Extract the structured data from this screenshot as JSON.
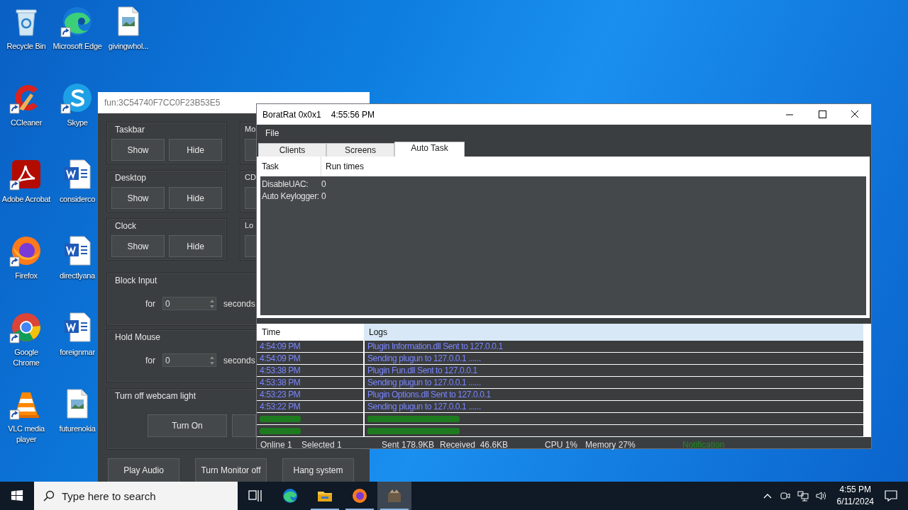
{
  "desktop_icons": [
    {
      "label": "Recycle Bin",
      "kind": "recycle-bin",
      "shortcut": false
    },
    {
      "label": "CCleaner",
      "kind": "ccleaner",
      "shortcut": true
    },
    {
      "label": "Adobe Acrobat",
      "kind": "acrobat",
      "shortcut": true
    },
    {
      "label": "Firefox",
      "kind": "firefox",
      "shortcut": true
    },
    {
      "label": "Google Chrome",
      "kind": "chrome",
      "shortcut": true
    },
    {
      "label": "VLC media player",
      "kind": "vlc",
      "shortcut": true
    },
    {
      "label": "Microsoft Edge",
      "kind": "edge",
      "shortcut": true
    },
    {
      "label": "Skype",
      "kind": "skype",
      "shortcut": true
    },
    {
      "label": "considerco",
      "kind": "word-doc",
      "shortcut": false
    },
    {
      "label": "directlyana",
      "kind": "word-doc",
      "shortcut": false
    },
    {
      "label": "foreignmar",
      "kind": "word-doc",
      "shortcut": false
    },
    {
      "label": "futurenokia",
      "kind": "image-file",
      "shortcut": false
    },
    {
      "label": "givingwhol...",
      "kind": "image-file",
      "shortcut": false
    }
  ],
  "fun_window": {
    "title": "fun:3C54740F7CC0F23B53E5",
    "groups": [
      {
        "title": "Taskbar",
        "buttons": [
          "Show",
          "Hide"
        ]
      },
      {
        "title": "Mo"
      },
      {
        "title": "Desktop",
        "buttons": [
          "Show",
          "Hide"
        ]
      },
      {
        "title": "CD"
      },
      {
        "title": "Clock",
        "buttons": [
          "Show",
          "Hide"
        ]
      },
      {
        "title": "Lo"
      }
    ],
    "timers": [
      {
        "title": "Block Input",
        "for": "for",
        "value": "0",
        "unit": "seconds"
      },
      {
        "title": "Hold Mouse",
        "for": "for",
        "value": "0",
        "unit": "seconds"
      }
    ],
    "webcam": {
      "title": "Turn off webcam light",
      "button": "Turn On"
    },
    "bottom_buttons": [
      "Play Audio",
      "Turn Monitor off",
      "Hang system"
    ]
  },
  "rat_window": {
    "title": "BoratRat 0x0x1",
    "time": "4:55:56 PM",
    "menu": [
      "File"
    ],
    "tabs": [
      {
        "label": "Clients",
        "selected": false
      },
      {
        "label": "Screens",
        "selected": false
      },
      {
        "label": "Auto Task",
        "selected": true
      }
    ],
    "task_table": {
      "columns": [
        "Task",
        "Run times"
      ],
      "rows": [
        [
          "DisableUAC:",
          "0"
        ],
        [
          "Auto Keylogger:",
          "0"
        ]
      ]
    },
    "log_table": {
      "columns": [
        "Time",
        "Logs"
      ],
      "rows": [
        {
          "time": "4:54:09 PM",
          "message": "Plugin Information.dll Sent to 127.0.0.1",
          "kind": "info"
        },
        {
          "time": "4:54:09 PM",
          "message": "Sending plugun to 127.0.0.1 ......",
          "kind": "info"
        },
        {
          "time": "4:53:38 PM",
          "message": "Plugin Fun.dll Sent to 127.0.0.1",
          "kind": "info"
        },
        {
          "time": "4:53:38 PM",
          "message": "Sending plugun to 127.0.0.1 ......",
          "kind": "info"
        },
        {
          "time": "4:53:23 PM",
          "message": "Plugin Options.dll Sent to 127.0.0.1",
          "kind": "info"
        },
        {
          "time": "4:53:22 PM",
          "message": "Sending plugun to 127.0.0.1 ......",
          "kind": "info"
        },
        {
          "kind": "success"
        },
        {
          "kind": "success"
        }
      ]
    },
    "status_bar": [
      {
        "text": "Online 1",
        "kind": "stat"
      },
      {
        "text": "Selected 1",
        "kind": "stat"
      },
      {
        "text": "Sent 178.9KB",
        "kind": "stat"
      },
      {
        "text": "Received  46.6KB",
        "kind": "stat"
      },
      {
        "text": "CPU 1%",
        "kind": "stat"
      },
      {
        "text": "Memory 27%",
        "kind": "stat"
      },
      {
        "text": "Notification",
        "kind": "notification"
      }
    ]
  },
  "taskbar": {
    "search_placeholder": "Type here to search",
    "apps": [
      {
        "kind": "task-view",
        "running": false,
        "selected": false
      },
      {
        "kind": "edge",
        "running": false,
        "selected": false
      },
      {
        "kind": "folder",
        "running": true,
        "selected": false
      },
      {
        "kind": "firefox",
        "running": true,
        "selected": false
      },
      {
        "kind": "rat",
        "running": true,
        "selected": true
      }
    ],
    "time": "4:55 PM",
    "date": "6/11/2024"
  }
}
